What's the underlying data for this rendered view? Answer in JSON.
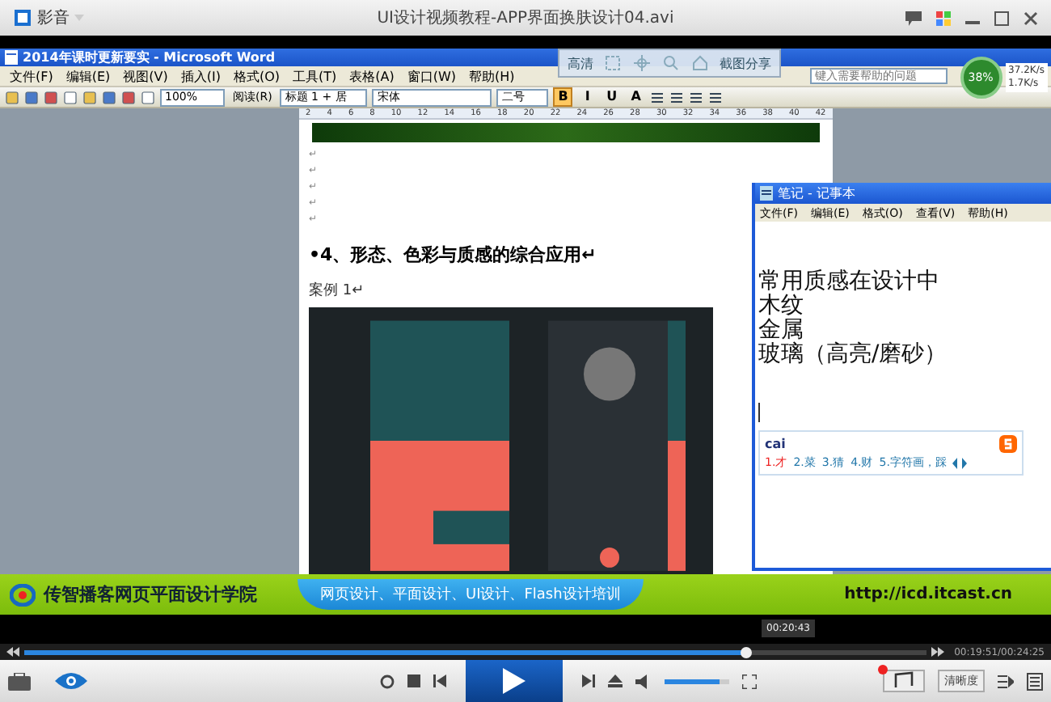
{
  "player": {
    "logo": "影音",
    "title": "UI设计视频教程-APP界面换肤设计04.avi"
  },
  "overlay_controls": [
    {
      "label": "高清"
    },
    {
      "label": "截图分享"
    }
  ],
  "word": {
    "title": "2014年课时更新要实 - Microsoft Word",
    "menu": [
      "文件(F)",
      "编辑(E)",
      "视图(V)",
      "插入(I)",
      "格式(O)",
      "工具(T)",
      "表格(A)",
      "窗口(W)",
      "帮助(H)"
    ],
    "help_placeholder": "键入需要帮助的问题",
    "toolbar": {
      "zoom": "100%",
      "read": "阅读(R)",
      "style": "标题 1 + 居",
      "font": "宋体",
      "size": "二号",
      "format_buttons": [
        {
          "label": "B",
          "selected": true
        },
        {
          "label": "I",
          "selected": false
        },
        {
          "label": "U",
          "selected": false
        },
        {
          "label": "A",
          "selected": false
        }
      ]
    },
    "ruler": [
      "2",
      "4",
      "6",
      "8",
      "10",
      "12",
      "14",
      "16",
      "18",
      "20",
      "22",
      "24",
      "26",
      "28",
      "30",
      "32",
      "34",
      "36",
      "38",
      "40",
      "42"
    ],
    "document": {
      "empty_paragraphs": [
        "↵",
        "↵",
        "↵",
        "↵",
        "↵"
      ],
      "heading": "•4、形态、色彩与质感的综合应用↵",
      "caption": "案例 1↵"
    }
  },
  "network": {
    "percent": "38%",
    "upload": "37.2K/s",
    "download": "1.7K/s"
  },
  "notepad": {
    "title": "笔记 - 记事本",
    "menu": [
      "文件(F)",
      "编辑(E)",
      "格式(O)",
      "查看(V)",
      "帮助(H)"
    ],
    "lines": [
      "常用质感在设计中",
      "木纹",
      "金属",
      "玻璃（高亮/磨砂）"
    ],
    "ime": {
      "input": "cai",
      "candidates": [
        "1.才",
        "2.菜",
        "3.猜",
        "4.财",
        "5.字符画，踩"
      ]
    }
  },
  "banner": {
    "school": "传智播客网页平面设计学院",
    "courses": "网页设计、平面设计、UI设计、Flash设计培训",
    "url": "http://icd.itcast.cn"
  },
  "playback": {
    "tooltip": "00:20:43",
    "time": "00:19:51/00:24:25",
    "level": 0.8,
    "volume": {
      "level": 0.85
    },
    "quality": "清晰度"
  }
}
